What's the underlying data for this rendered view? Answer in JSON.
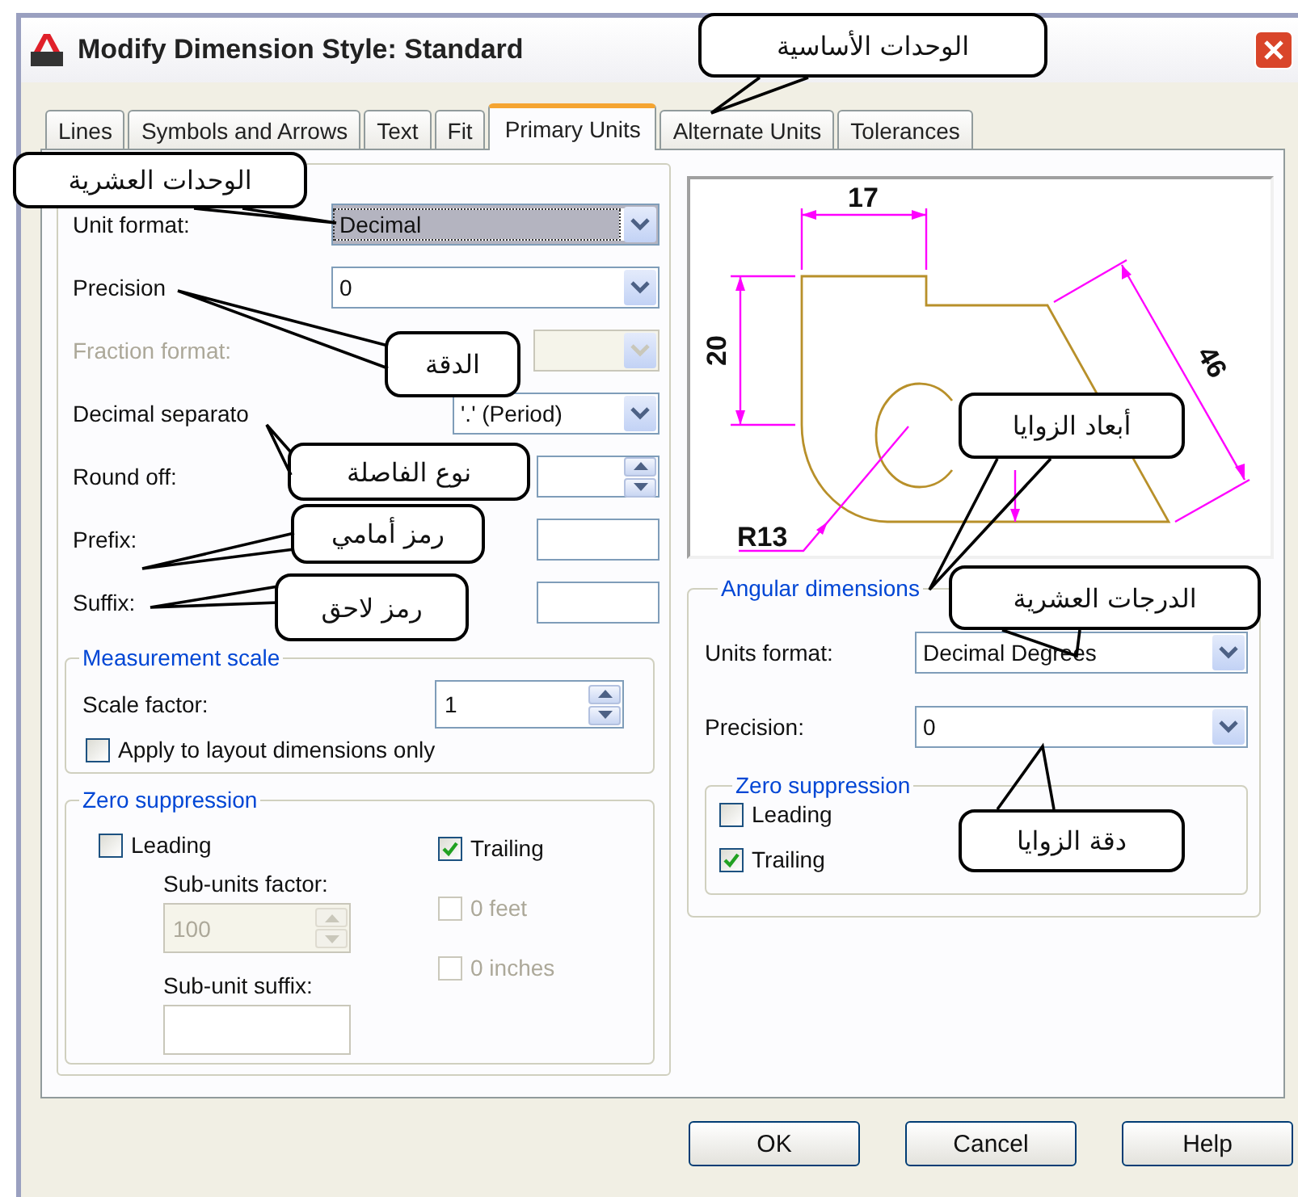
{
  "window": {
    "title": "Modify Dimension Style: Standard"
  },
  "tabs": [
    {
      "label": "Lines",
      "selected": false
    },
    {
      "label": "Symbols and Arrows",
      "selected": false
    },
    {
      "label": "Text",
      "selected": false
    },
    {
      "label": "Fit",
      "selected": false
    },
    {
      "label": "Primary Units",
      "selected": true
    },
    {
      "label": "Alternate Units",
      "selected": false
    },
    {
      "label": "Tolerances",
      "selected": false
    }
  ],
  "primary_fields": [
    {
      "kind": "dropdown",
      "label": "Unit format:",
      "value": "Decimal",
      "highlighted": true,
      "disabled": false
    },
    {
      "kind": "dropdown",
      "label": "Precision",
      "value": "0",
      "highlighted": false,
      "disabled": false
    },
    {
      "kind": "dropdown",
      "label": "Fraction format:",
      "highlighted": false,
      "disabled": true
    },
    {
      "kind": "dropdown",
      "label": "Decimal separato",
      "value": "'.' (Period)",
      "highlighted": false,
      "disabled": false
    },
    {
      "kind": "spinner",
      "label": "Round off:",
      "highlighted": false,
      "disabled": false
    },
    {
      "kind": "text",
      "label": "Prefix:",
      "highlighted": false,
      "disabled": false
    },
    {
      "kind": "text",
      "label": "Suffix:",
      "highlighted": false,
      "disabled": false
    }
  ],
  "measurement_scale": {
    "title": "Measurement scale",
    "scale_label": "Scale factor:",
    "scale_value": "1",
    "apply_label": "Apply to layout dimensions only",
    "apply_checked": false
  },
  "zero_suppression": {
    "title": "Zero suppression",
    "checks": [
      {
        "label": "Leading",
        "checked": false,
        "disabled": false
      },
      {
        "label": "Trailing",
        "checked": true,
        "disabled": false
      },
      {
        "label": "0 feet",
        "checked": false,
        "disabled": true
      },
      {
        "label": "0 inches",
        "checked": false,
        "disabled": true
      }
    ],
    "sub_units_factor_label": "Sub-units factor:",
    "sub_units_factor_value": "100",
    "sub_unit_suffix_label": "Sub-unit suffix:"
  },
  "preview": {
    "width_dim": "17",
    "height_dim": "20",
    "slant_dim": "46",
    "radius_dim": "R13"
  },
  "angular": {
    "title": "Angular dimensions",
    "fields": [
      {
        "label": "Units format:",
        "value": "Decimal Degrees"
      },
      {
        "label": "Precision:",
        "value": "0"
      }
    ],
    "zero_suppression": {
      "title": "Zero suppression",
      "checks": [
        {
          "label": "Leading",
          "checked": false
        },
        {
          "label": "Trailing",
          "checked": true
        }
      ]
    }
  },
  "buttons": [
    "OK",
    "Cancel",
    "Help"
  ],
  "callouts": [
    "الوحدات الأساسية",
    "الوحدات العشرية",
    "الدقة",
    "نوع الفاصلة",
    "رمز أمامي",
    "رمز لاحق",
    "أبعاد الزوايا",
    "الدرجات العشرية",
    "دقة الزوايا"
  ]
}
